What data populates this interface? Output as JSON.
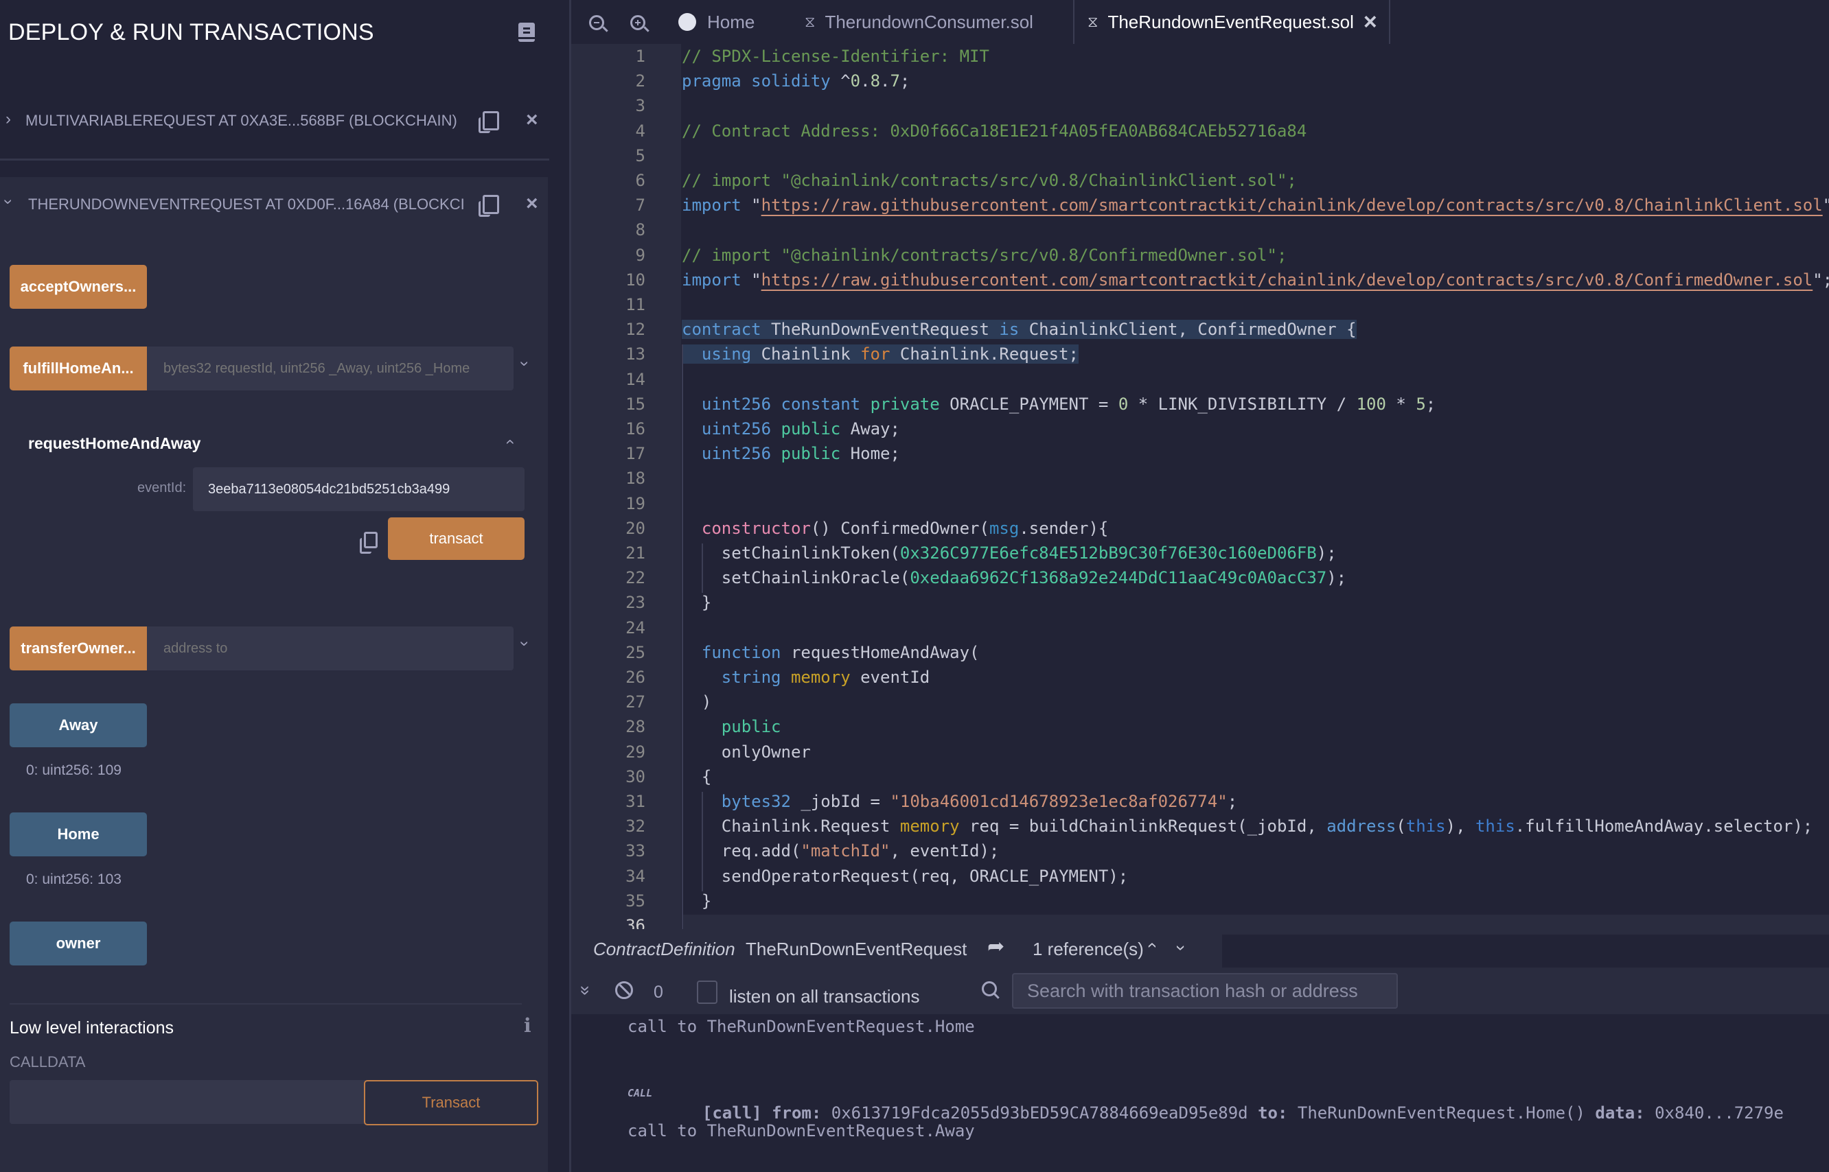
{
  "panel": {
    "title": "DEPLOY & RUN TRANSACTIONS",
    "book_icon": "book-icon",
    "instances": [
      {
        "label": "MULTIVARIABLEREQUEST AT 0XA3E...568BF (BLOCKCHAIN)",
        "expanded": false
      },
      {
        "label": "THERUNDOWNEVENTREQUEST AT 0XD0F...16A84 (BLOCKCI",
        "expanded": true
      }
    ],
    "functions": {
      "acceptOwnership": {
        "label": "acceptOwners..."
      },
      "fulfill": {
        "label": "fulfillHomeAn...",
        "placeholder": "bytes32 requestId, uint256 _Away, uint256 _Home"
      },
      "request": {
        "title": "requestHomeAndAway",
        "param_label": "eventId:",
        "param_value": "3eeba7113e08054dc21bd5251cb3a499",
        "transact_label": "transact"
      },
      "transferOwnership": {
        "label": "transferOwner...",
        "placeholder": "address to"
      },
      "away": {
        "label": "Away",
        "output": "0: uint256: 109"
      },
      "home": {
        "label": "Home",
        "output": "0: uint256: 103"
      },
      "owner": {
        "label": "owner"
      }
    },
    "low_level": {
      "title": "Low level interactions",
      "calldata_label": "CALLDATA",
      "calldata_value": "",
      "transact_label": "Transact"
    }
  },
  "tabs": [
    {
      "label": "Home",
      "icon": "remix-logo-icon",
      "active": false
    },
    {
      "label": "TherundownConsumer.sol",
      "icon": "solidity-icon",
      "active": false
    },
    {
      "label": "TheRundownEventRequest.sol",
      "icon": "solidity-icon",
      "active": true,
      "closable": true
    }
  ],
  "editor": {
    "lines": [
      "// SPDX-License-Identifier: MIT",
      "pragma solidity ^0.8.7;",
      "",
      "// Contract Address: 0xD0f66Ca18E1E21f4A05fEA0AB684CAEb52716a84",
      "",
      "// import \"@chainlink/contracts/src/v0.8/ChainlinkClient.sol\";",
      "import \"https://raw.githubusercontent.com/smartcontractkit/chainlink/develop/contracts/src/v0.8/ChainlinkClient.sol\"",
      "",
      "// import \"@chainlink/contracts/src/v0.8/ConfirmedOwner.sol\";",
      "import \"https://raw.githubusercontent.com/smartcontractkit/chainlink/develop/contracts/src/v0.8/ConfirmedOwner.sol\";",
      "",
      "contract TheRunDownEventRequest is ChainlinkClient, ConfirmedOwner {",
      "  using Chainlink for Chainlink.Request;",
      "",
      "  uint256 constant private ORACLE_PAYMENT = 0 * LINK_DIVISIBILITY / 100 * 5;",
      "  uint256 public Away;",
      "  uint256 public Home;",
      "",
      "",
      "  constructor() ConfirmedOwner(msg.sender){",
      "    setChainlinkToken(0x326C977E6efc84E512bB9C30f76E30c160eD06FB);",
      "    setChainlinkOracle(0xedaa6962Cf1368a92e244DdC11aaC49c0A0acC37);",
      "  }",
      "",
      "  function requestHomeAndAway(",
      "    string memory eventId",
      "  )",
      "    public",
      "    onlyOwner",
      "  {",
      "    bytes32 _jobId = \"10ba46001cd14678923e1ec8af026774\";",
      "    Chainlink.Request memory req = buildChainlinkRequest(_jobId, address(this), this.fulfillHomeAndAway.selector);",
      "    req.add(\"matchId\", eventId);",
      "    sendOperatorRequest(req, ORACLE_PAYMENT);",
      "  }",
      ""
    ],
    "reference": {
      "kind": "ContractDefinition",
      "name": "TheRunDownEventRequest",
      "count_label": "1 reference(s)"
    }
  },
  "terminal": {
    "pending_count": "0",
    "listen_label": "listen on all transactions",
    "listen_checked": false,
    "search_placeholder": "Search with transaction hash or address",
    "entries": [
      {
        "text": "call to TheRunDownEventRequest.Home"
      },
      {
        "badge": "CALL",
        "type": "[call]",
        "from_label": "from:",
        "from": "0x613719Fdca2055d93bED59CA7884669eaD95e89d",
        "to_label": "to:",
        "to": "TheRunDownEventRequest.Home()",
        "data_label": "data:",
        "data": "0x840...7279e"
      },
      {
        "text": "call to TheRunDownEventRequest.Away"
      }
    ]
  }
}
